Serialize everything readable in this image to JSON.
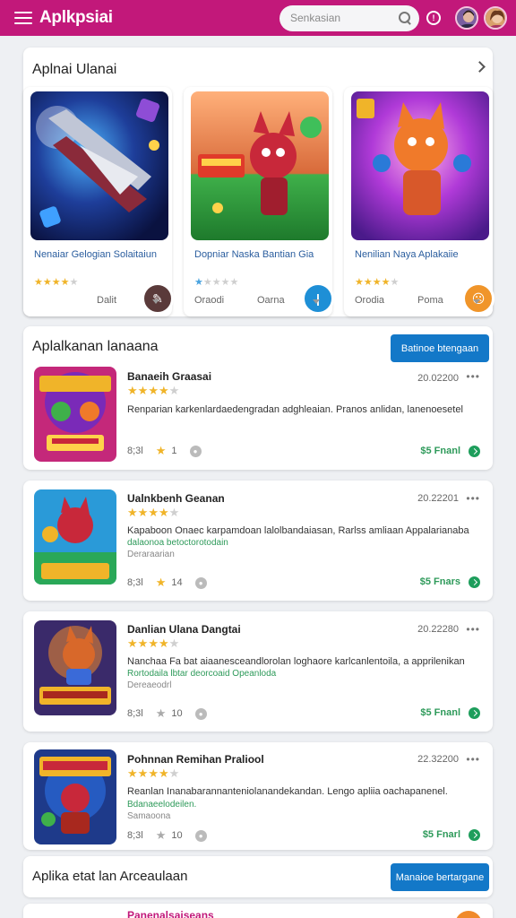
{
  "header": {
    "title": "Aplkpsiai",
    "search_placeholder": "Senkasian"
  },
  "featured": {
    "title": "Aplnai Ulanai",
    "cards": [
      {
        "name": "Nenaiar Gelogian Solaitaiun",
        "rating": 3.5,
        "meta1": "",
        "meta2": "Dalit",
        "badge_color": "#5a3a3a",
        "badge_glyph": "✎"
      },
      {
        "name": "Dopniar Naska Bantian Gia",
        "rating": 1,
        "meta1": "Oraodi",
        "meta2": "Oarna",
        "badge_color": "#1e8fd6",
        "badge_glyph": "|"
      },
      {
        "name": "Nenilian Naya Aplakaiie",
        "rating": 3.5,
        "meta1": "Orodia",
        "meta2": "Poma",
        "badge_color": "#f0952a",
        "badge_glyph": "☹"
      }
    ]
  },
  "list": {
    "title": "Aplalkanan lanaana",
    "button": "Batinoe btengaan",
    "items": [
      {
        "title": "Banaeih Graasai",
        "date": "20.02200",
        "rating": 3.5,
        "desc": "Renparian karkenlardaedengradan adghleaian. Pranos anlidan, lanenoesetel",
        "sub": "",
        "sub2": "",
        "size": "8;3l",
        "count": "1",
        "count_grey": false,
        "price": "$5 Fnanl"
      },
      {
        "title": "Ualnkbenh Geanan",
        "date": "20.22201",
        "rating": 3.5,
        "desc": "Kapaboon Onaec karpamdoan lalolbandaiasan, Rarlss amliaan Appalarianaba",
        "sub": "dalaonoa betoctorotodain",
        "sub2": "Deraraarian",
        "size": "8;3l",
        "count": "14",
        "count_grey": false,
        "price": "$5 Fnars"
      },
      {
        "title": "Danlian Ulana Dangtai",
        "date": "20.22280",
        "rating": 3.5,
        "desc": "Nanchaa Fa bat aiaanesceandlorolan loghaore karlcanlentoila, a apprilenikan",
        "sub": "Rortodaila lbtar deorcoaid Opeanloda",
        "sub2": "Dereaeodrl",
        "size": "8;3l",
        "count": "10",
        "count_grey": true,
        "price": "$5 Fnanl"
      },
      {
        "title": "Pohnnan Remihan Praliool",
        "date": "22.32200",
        "rating": 3.5,
        "desc": "Reanlan Inanabarannanteniolanandekandan. Lengo apliia oachapanenel.",
        "sub": "Bdanaeelodeilen.",
        "sub2": "Samaoona",
        "size": "8;3l",
        "count": "10",
        "count_grey": true,
        "price": "$5 Fnarl"
      }
    ]
  },
  "bottom": {
    "title": "Aplika etat lan Arceaulaan",
    "button": "Manaioe bertargane",
    "peek_title": "Panenalsaiseans"
  }
}
